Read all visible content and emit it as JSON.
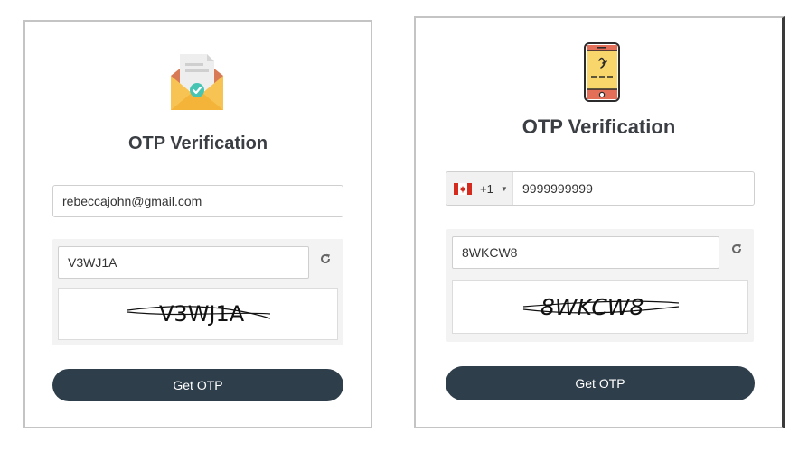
{
  "colors": {
    "button_bg": "#2f3e4b",
    "button_text": "#ffffff",
    "title": "#3b3f44",
    "card_border": "#c4c4c4",
    "captcha_panel": "#f3f3f3"
  },
  "email_card": {
    "illustration": "envelope-check-icon",
    "title": "OTP Verification",
    "email_value": "rebeccajohn@gmail.com",
    "captcha_input_value": "V3WJ1A",
    "captcha_text": "V3WJ1A",
    "refresh_icon": "refresh-icon",
    "button_label": "Get OTP"
  },
  "phone_card": {
    "illustration": "mobile-phone-icon",
    "title": "OTP Verification",
    "country_flag": "canada-flag-icon",
    "dial_code": "+1",
    "phone_value": "9999999999",
    "captcha_input_value": "8WKCW8",
    "captcha_text": "8WKCW8",
    "refresh_icon": "refresh-icon",
    "button_label": "Get OTP"
  }
}
